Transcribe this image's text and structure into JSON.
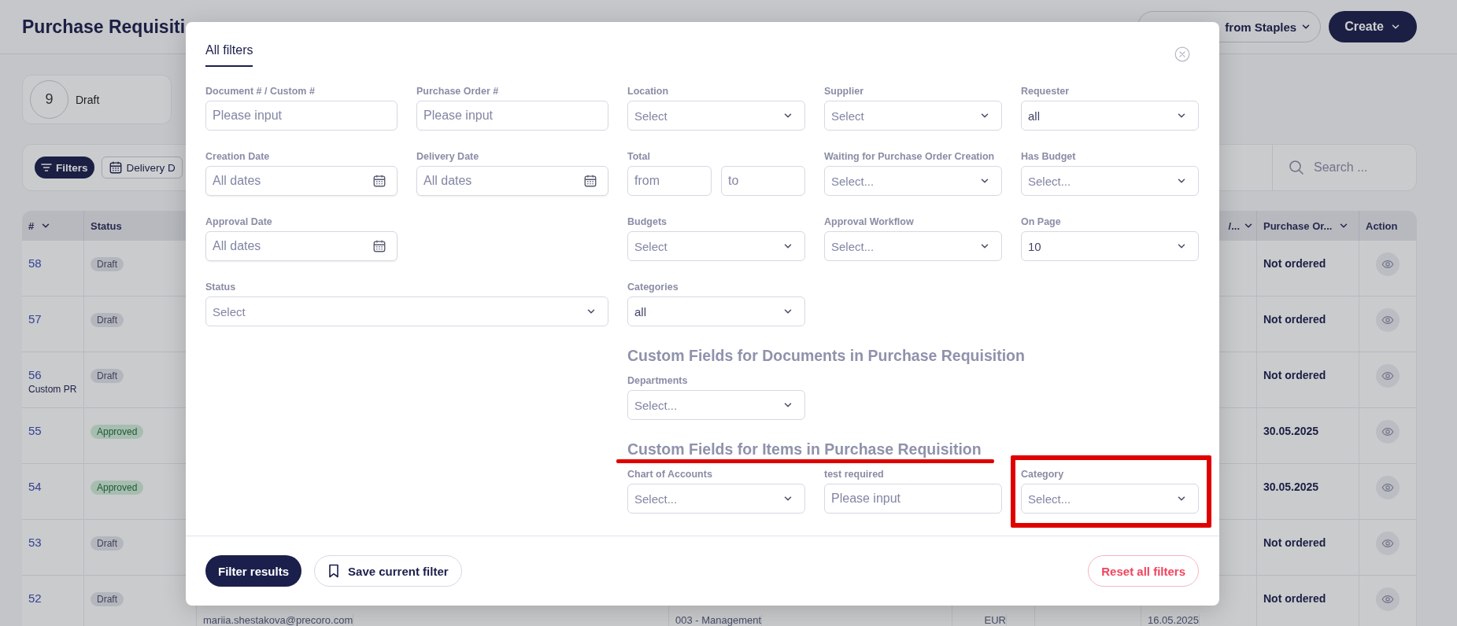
{
  "header": {
    "title": "Purchase Requisiti",
    "buttons": [
      {
        "label": "from Staples",
        "kind": "outline"
      },
      {
        "label": "Create",
        "kind": "primary"
      }
    ]
  },
  "status_cards": [
    {
      "count": "9",
      "label": "Draft"
    }
  ],
  "toolbar": {
    "buttons": [
      {
        "label": "Filters",
        "kind": "primary"
      },
      {
        "label": "Delivery D",
        "kind": "calendar"
      }
    ],
    "search": {
      "placeholder": "Search ..."
    }
  },
  "table": {
    "columns": [
      {
        "label": "#",
        "sortable": true
      },
      {
        "label": "Status",
        "sortable": false
      },
      {
        "label": "/...",
        "sortable": true
      },
      {
        "label": "Purchase Or...",
        "sortable": true
      },
      {
        "label": "Action",
        "sortable": false
      }
    ],
    "rows": [
      {
        "number": "58",
        "status": {
          "label": "Draft",
          "kind": "draft"
        },
        "purchase_order": "Not ordered"
      },
      {
        "number": "57",
        "status": {
          "label": "Draft",
          "kind": "draft"
        },
        "purchase_order": "Not ordered"
      },
      {
        "number": "56",
        "note": "Custom PR",
        "status": {
          "label": "Draft",
          "kind": "draft"
        },
        "purchase_order": "Not ordered"
      },
      {
        "number": "55",
        "status": {
          "label": "Approved",
          "kind": "approved"
        },
        "purchase_order": "30.05.2025"
      },
      {
        "number": "54",
        "status": {
          "label": "Approved",
          "kind": "approved"
        },
        "purchase_order": "30.05.2025"
      },
      {
        "number": "53",
        "status": {
          "label": "Draft",
          "kind": "draft"
        },
        "purchase_order": "Not ordered"
      },
      {
        "number": "52",
        "status": {
          "label": "Draft",
          "kind": "draft"
        },
        "purchase_order": "Not ordered",
        "details": [
          "mariia.shestakova@precoro.com",
          "003 - Management",
          "EUR",
          "16.05.2025"
        ]
      }
    ]
  },
  "modal": {
    "tabs": [
      {
        "label": "All filters",
        "selected": true
      }
    ],
    "filters": [
      {
        "label": "Document # / Custom #",
        "kind": "text",
        "placeholder": "Please input"
      },
      {
        "label": "Purchase Order #",
        "kind": "text",
        "placeholder": "Please input"
      },
      {
        "label": "Location",
        "kind": "select",
        "placeholder": "Select"
      },
      {
        "label": "Supplier",
        "kind": "select",
        "placeholder": "Select"
      },
      {
        "label": "Requester",
        "kind": "select",
        "value": "all"
      },
      {
        "label": "Creation Date",
        "kind": "date",
        "placeholder": "All dates"
      },
      {
        "label": "Delivery Date",
        "kind": "date",
        "placeholder": "All dates"
      },
      {
        "label": "Total",
        "kind": "range",
        "from": {
          "placeholder": "from"
        },
        "to": {
          "placeholder": "to"
        }
      },
      {
        "label": "Waiting for Purchase Order Creation",
        "kind": "select",
        "placeholder": "Select..."
      },
      {
        "label": "Has Budget",
        "kind": "select",
        "placeholder": "Select..."
      },
      {
        "label": "Approval Date",
        "kind": "date",
        "placeholder": "All dates"
      },
      {
        "label": "Budgets",
        "kind": "select",
        "placeholder": "Select"
      },
      {
        "label": "Approval Workflow",
        "kind": "select",
        "placeholder": "Select..."
      },
      {
        "label": "On Page",
        "kind": "select",
        "value": "10"
      },
      {
        "label": "Status",
        "kind": "select",
        "placeholder": "Select"
      },
      {
        "label": "Categories",
        "kind": "select",
        "value": "all"
      }
    ],
    "sections": [
      {
        "title": "Custom Fields for Documents in Purchase Requisition",
        "underlined": false,
        "fields": [
          {
            "label": "Departments",
            "kind": "select",
            "placeholder": "Select...",
            "highlighted": false
          }
        ]
      },
      {
        "title": "Custom Fields for Items in Purchase Requisition",
        "underlined": true,
        "fields": [
          {
            "label": "Chart of Accounts",
            "kind": "select",
            "placeholder": "Select...",
            "highlighted": false
          },
          {
            "label": "test required",
            "kind": "text",
            "placeholder": "Please input",
            "highlighted": false
          },
          {
            "label": "Category",
            "kind": "select",
            "placeholder": "Select...",
            "highlighted": true
          }
        ]
      }
    ],
    "footer": {
      "buttons": [
        {
          "label": "Filter results",
          "kind": "primary"
        },
        {
          "label": "Save current filter",
          "kind": "bookmark"
        },
        {
          "label": "Reset all filters",
          "kind": "danger"
        }
      ]
    }
  }
}
